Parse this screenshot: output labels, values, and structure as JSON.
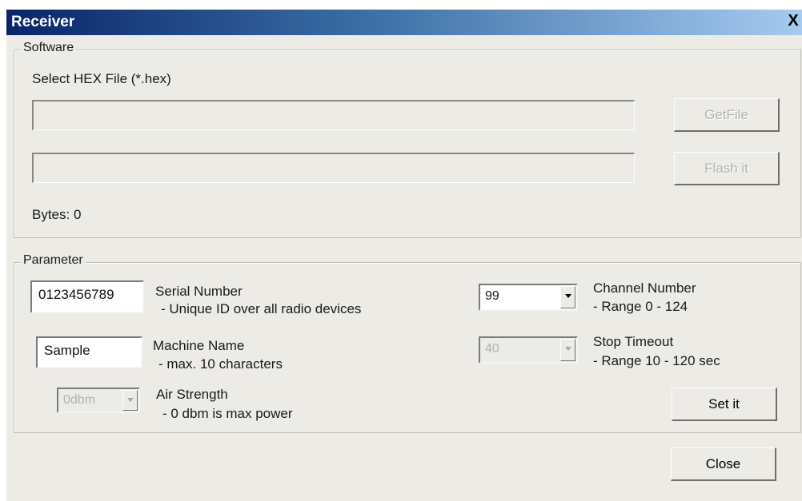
{
  "window": {
    "title": "Receiver",
    "close_glyph": "X"
  },
  "software": {
    "legend": "Software",
    "select_label": "Select HEX File (*.hex)",
    "file_path_value": "",
    "flash_progress_value": "",
    "getfile_label": "GetFile",
    "flash_label": "Flash it",
    "bytes_label": "Bytes: 0"
  },
  "parameter": {
    "legend": "Parameter",
    "serial": {
      "value": "0123456789",
      "label": "Serial Number",
      "hint": "- Unique ID over all radio devices"
    },
    "machine": {
      "value": "Sample",
      "label": "Machine Name",
      "hint": "- max. 10 characters"
    },
    "air": {
      "value": "0dbm",
      "label": "Air Strength",
      "hint": "- 0 dbm is max power"
    },
    "channel": {
      "value": "99",
      "label": "Channel Number",
      "hint": "- Range  0 - 124"
    },
    "timeout": {
      "value": "40",
      "label": "Stop Timeout",
      "hint": "- Range 10 - 120 sec"
    },
    "set_label": "Set it"
  },
  "footer": {
    "close_label": "Close"
  },
  "colors": {
    "title_start": "#0a246a",
    "title_end": "#a6caf0",
    "face": "#ecebe5"
  }
}
